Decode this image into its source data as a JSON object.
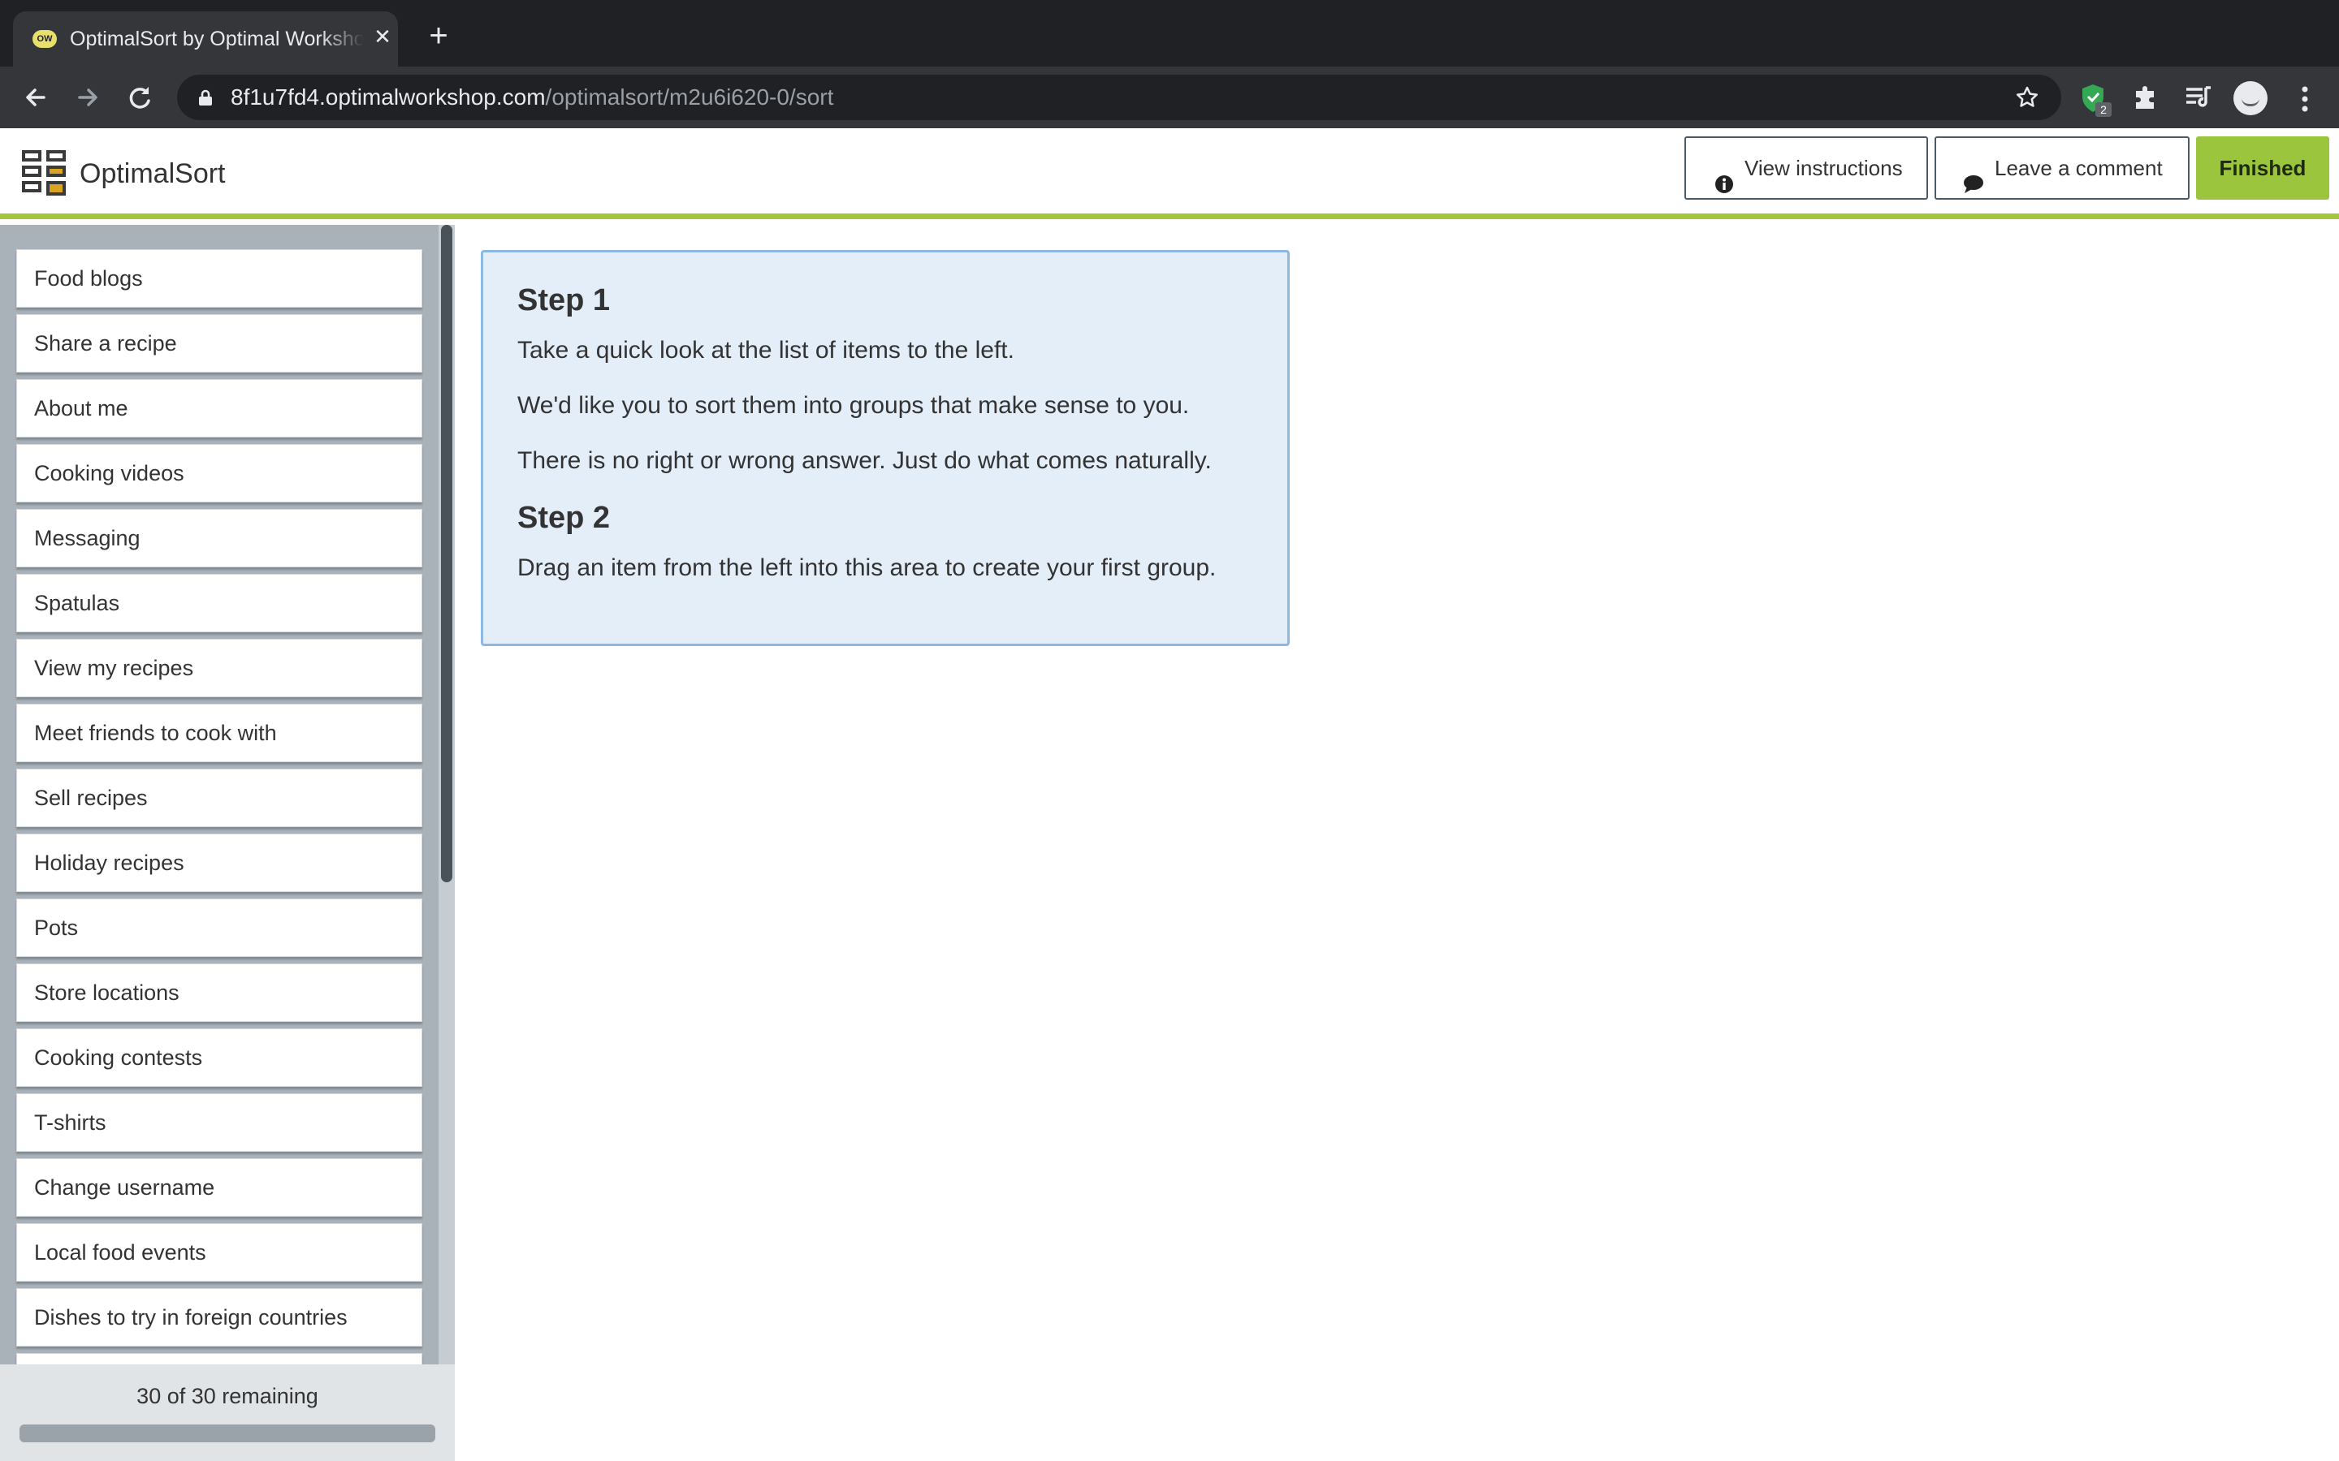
{
  "browser": {
    "tab_title": "OptimalSort by Optimal Workshop",
    "favicon_text": "OW",
    "url_host": "8f1u7fd4.optimalworkshop.com",
    "url_path": "/optimalsort/m2u6i620-0/sort",
    "extension_badge": "2"
  },
  "header": {
    "app_name": "OptimalSort",
    "view_instructions_label": "View instructions",
    "leave_comment_label": "Leave a comment",
    "finished_label": "Finished",
    "accent_color": "#9bc53d"
  },
  "sidebar": {
    "cards": [
      "Food blogs",
      "Share a recipe",
      "About me",
      "Cooking videos",
      "Messaging",
      "Spatulas",
      "View my recipes",
      "Meet friends to cook with",
      "Sell recipes",
      "Holiday recipes",
      "Pots",
      "Store locations",
      "Cooking contests",
      "T-shirts",
      "Change username",
      "Local food events",
      "Dishes to try in foreign countries"
    ],
    "remaining_text": "30 of 30 remaining",
    "progress_fraction": 0
  },
  "instructions": {
    "step1_title": "Step 1",
    "step1_line1": "Take a quick look at the list of items to the left.",
    "step1_line2": "We'd like you to sort them into groups that make sense to you.",
    "step1_line3": "There is no right or wrong answer. Just do what comes naturally.",
    "step2_title": "Step 2",
    "step2_line1": "Drag an item from the left into this area to create your first group."
  }
}
